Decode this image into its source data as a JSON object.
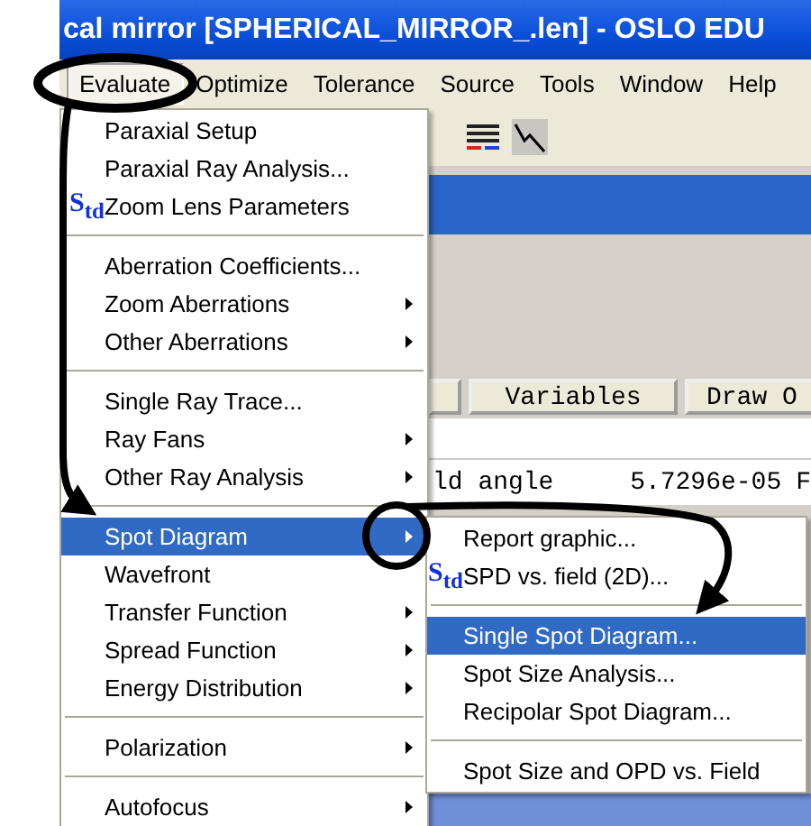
{
  "window": {
    "title": "cal mirror [SPHERICAL_MIRROR_.len] - OSLO EDU"
  },
  "menubar": [
    {
      "label": "Evaluate",
      "selected": true
    },
    {
      "label": "Optimize",
      "selected": false
    },
    {
      "label": "Tolerance",
      "selected": false
    },
    {
      "label": "Source",
      "selected": false
    },
    {
      "label": "Tools",
      "selected": false
    },
    {
      "label": "Window",
      "selected": false
    },
    {
      "label": "Help",
      "selected": false
    }
  ],
  "background": {
    "buttons": [
      "Variables",
      "Draw O"
    ],
    "row": [
      "ld angle",
      "5.7296e-05",
      "F"
    ]
  },
  "evaluate_menu": [
    {
      "kind": "item",
      "label": "Paraxial Setup",
      "submenu": false,
      "selected": false
    },
    {
      "kind": "item",
      "label": "Paraxial Ray Analysis...",
      "submenu": false,
      "selected": false
    },
    {
      "kind": "item",
      "label": "Zoom Lens Parameters",
      "badge": "S$_{td}$",
      "submenu": false,
      "selected": false
    },
    {
      "kind": "separator"
    },
    {
      "kind": "item",
      "label": "Aberration Coefficients...",
      "submenu": false,
      "selected": false
    },
    {
      "kind": "item",
      "label": "Zoom Aberrations",
      "submenu": true,
      "selected": false
    },
    {
      "kind": "item",
      "label": "Other Aberrations",
      "submenu": true,
      "selected": false
    },
    {
      "kind": "separator"
    },
    {
      "kind": "item",
      "label": "Single Ray Trace...",
      "submenu": false,
      "selected": false
    },
    {
      "kind": "item",
      "label": "Ray Fans",
      "submenu": true,
      "selected": false
    },
    {
      "kind": "item",
      "label": "Other Ray Analysis",
      "submenu": true,
      "selected": false
    },
    {
      "kind": "separator"
    },
    {
      "kind": "item",
      "label": "Spot Diagram",
      "submenu": true,
      "selected": true
    },
    {
      "kind": "item",
      "label": "Wavefront",
      "submenu": false,
      "selected": false
    },
    {
      "kind": "item",
      "label": "Transfer Function",
      "submenu": true,
      "selected": false
    },
    {
      "kind": "item",
      "label": "Spread Function",
      "submenu": true,
      "selected": false
    },
    {
      "kind": "item",
      "label": "Energy Distribution",
      "submenu": true,
      "selected": false
    },
    {
      "kind": "separator"
    },
    {
      "kind": "item",
      "label": "Polarization",
      "submenu": true,
      "selected": false
    },
    {
      "kind": "separator"
    },
    {
      "kind": "item",
      "label": "Autofocus",
      "submenu": true,
      "selected": false
    }
  ],
  "spot_diagram_submenu": [
    {
      "kind": "item",
      "label": "Report graphic...",
      "submenu": false,
      "selected": false
    },
    {
      "kind": "item",
      "label": "SPD vs. field (2D)...",
      "badge": "S$_{td}$",
      "submenu": false,
      "selected": false
    },
    {
      "kind": "separator"
    },
    {
      "kind": "item",
      "label": "Single Spot Diagram...",
      "submenu": false,
      "selected": true
    },
    {
      "kind": "item",
      "label": "Spot Size Analysis...",
      "submenu": false,
      "selected": false
    },
    {
      "kind": "item",
      "label": "Recipolar Spot Diagram...",
      "submenu": false,
      "selected": false
    },
    {
      "kind": "separator"
    },
    {
      "kind": "item",
      "label": "Spot Size and OPD vs. Field",
      "submenu": false,
      "selected": false
    }
  ]
}
